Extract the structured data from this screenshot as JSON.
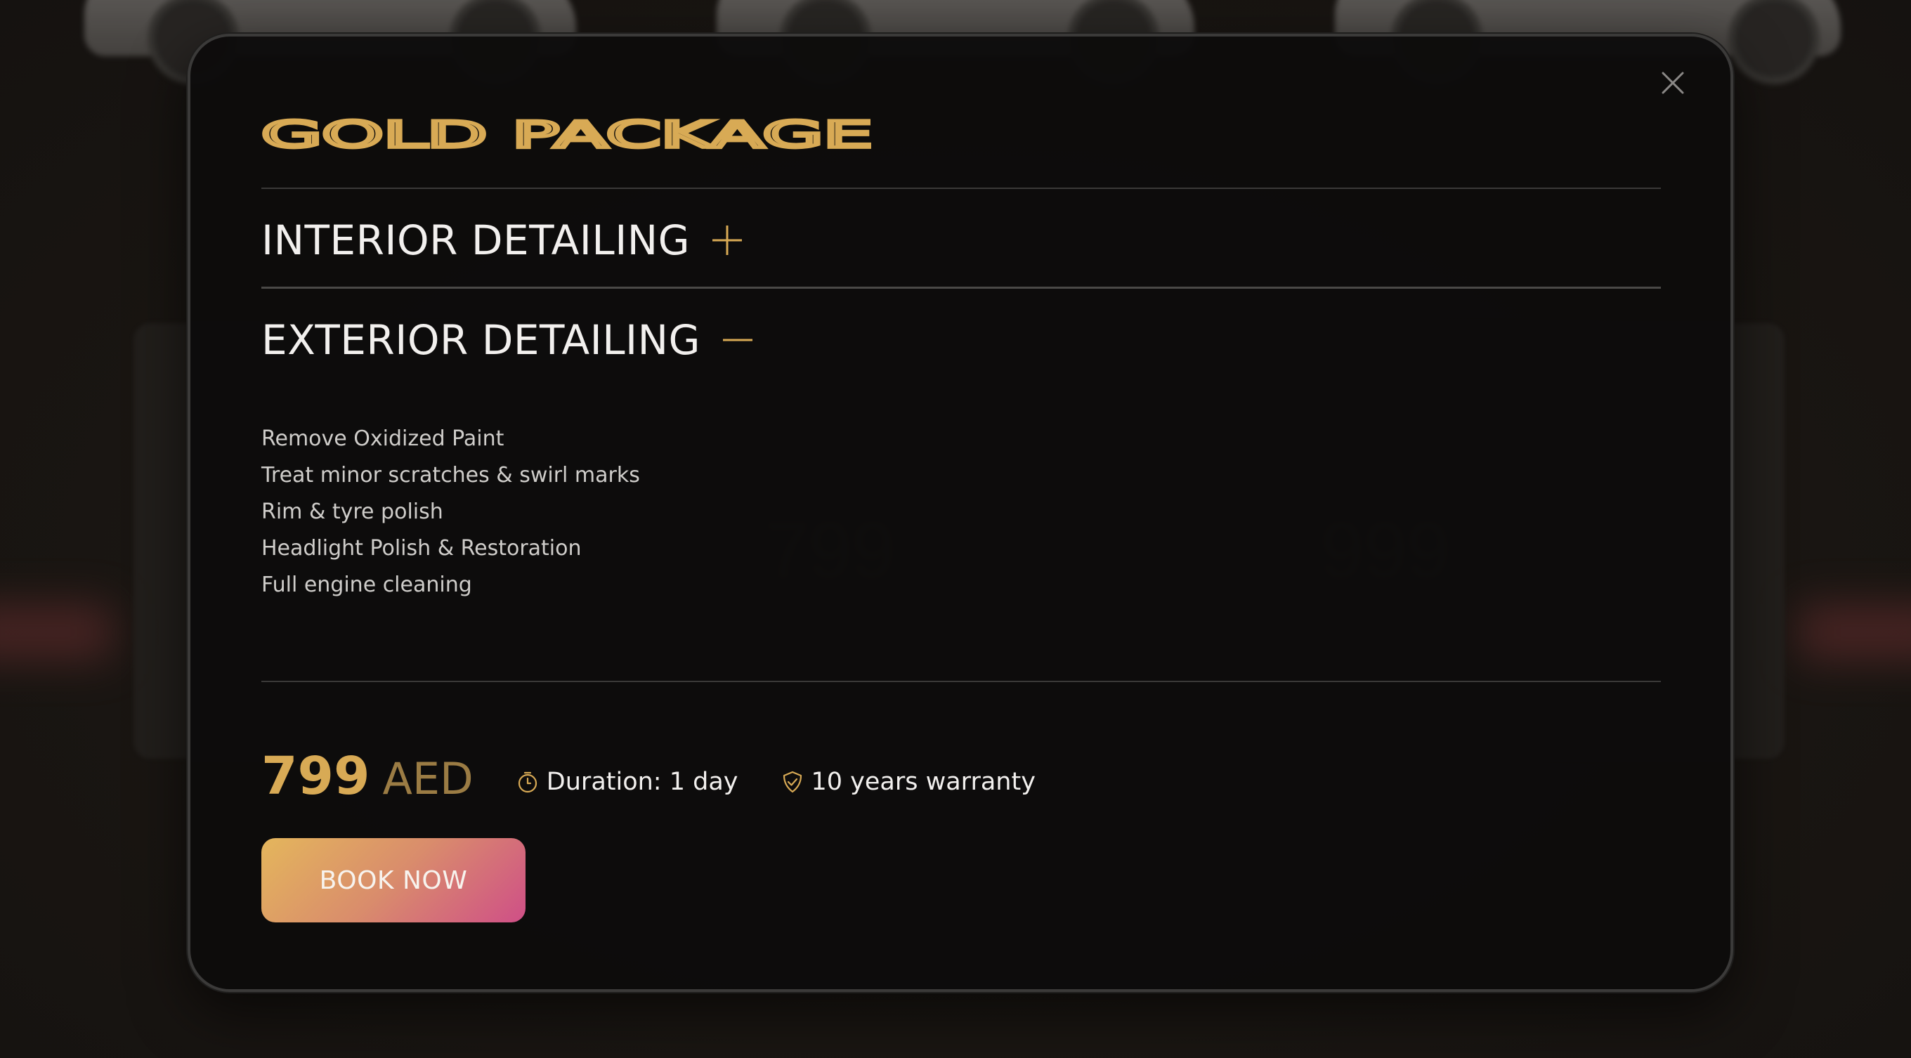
{
  "modal": {
    "title": "GOLD PACKAGE",
    "sections": [
      {
        "label": "INTERIOR DETAILING",
        "toggle_icon": "plus-icon",
        "expanded": false
      },
      {
        "label": "EXTERIOR DETAILING",
        "toggle_icon": "minus-icon",
        "expanded": true,
        "items": [
          "Remove Oxidized Paint",
          "Treat minor scratches & swirl marks",
          "Rim & tyre polish",
          "Headlight Polish & Restoration",
          "Full engine cleaning"
        ]
      }
    ],
    "price": {
      "value": "799",
      "currency": "AED"
    },
    "duration": {
      "icon": "stopwatch-icon",
      "text": "Duration: 1 day"
    },
    "warranty": {
      "icon": "shield-check-icon",
      "text": "10 years warranty"
    },
    "book_label": "BOOK NOW",
    "close_icon": "close-icon"
  },
  "background": {
    "cards": [
      {
        "title_line1": "",
        "price": ""
      },
      {
        "title_line1": "",
        "price": "799"
      },
      {
        "title_line1": "",
        "price": "999"
      }
    ]
  },
  "colors": {
    "gold": "#d8aa55",
    "text_light": "#f2f0ee",
    "text_muted": "#cfcdca",
    "button_gradient_start": "#e4b65c",
    "button_gradient_end": "#cf4f87",
    "modal_bg": "#0d0c0c"
  }
}
